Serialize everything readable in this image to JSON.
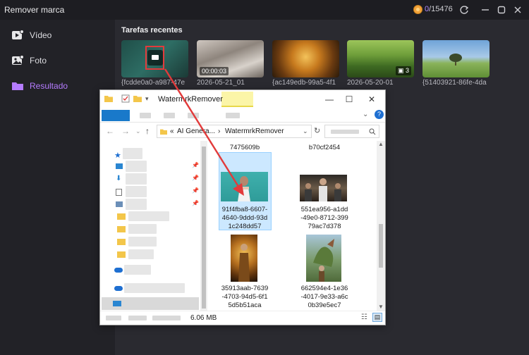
{
  "app": {
    "title": "Remover marca",
    "credits_used": "0",
    "credits_total": "/15476"
  },
  "sidebar": {
    "items": [
      {
        "label": "Vídeo",
        "icon": "video-icon",
        "active": false
      },
      {
        "label": "Foto",
        "icon": "photo-icon",
        "active": false
      },
      {
        "label": "Resultado",
        "icon": "folder-icon",
        "active": true
      }
    ]
  },
  "recent": {
    "title": "Tarefas recentes",
    "items": [
      {
        "caption": "{fcdde0a0-a987-47e",
        "badge": ""
      },
      {
        "caption": "2026-05-21_01",
        "badge": "00:00:03"
      },
      {
        "caption": "{ac149edb-99a5-4f1",
        "badge": ""
      },
      {
        "caption": "2026-05-20-01",
        "badge": "3"
      },
      {
        "caption": "{51403921-86fe-4da",
        "badge": ""
      }
    ]
  },
  "explorer": {
    "title": "WatermrkRemover",
    "address": {
      "prefix": "«",
      "crumb1": "AI Genera...",
      "sep": "›",
      "crumb2": "WatermrkRemover"
    },
    "files": [
      {
        "name": "7475609b"
      },
      {
        "name": "b70cf2454"
      },
      {
        "name": "91f4fba8-6607-4640-9ddd-93d1c248dd57",
        "lines": [
          "91f4fba8-6607-",
          "4640-9ddd-93d",
          "1c248dd57"
        ],
        "selected": true
      },
      {
        "name": "551ea956-a1dd-49e0-8712-39979ac7d378",
        "lines": [
          "551ea956-a1dd",
          "-49e0-8712-399",
          "79ac7d378"
        ]
      },
      {
        "name": "35913aab-7639-4703-94d5-6f15d5b51aca",
        "lines": [
          "35913aab-7639",
          "-4703-94d5-6f1",
          "5d5b51aca"
        ]
      },
      {
        "name": "662594e4-1e36-4017-9e33-a6c0b39e5ec7",
        "lines": [
          "662594e4-1e36",
          "-4017-9e33-a6c",
          "0b39e5ec7"
        ]
      }
    ],
    "status_size": "6.06 MB"
  },
  "colors": {
    "accent": "#b57cff",
    "annotation": "#e23b3b"
  }
}
